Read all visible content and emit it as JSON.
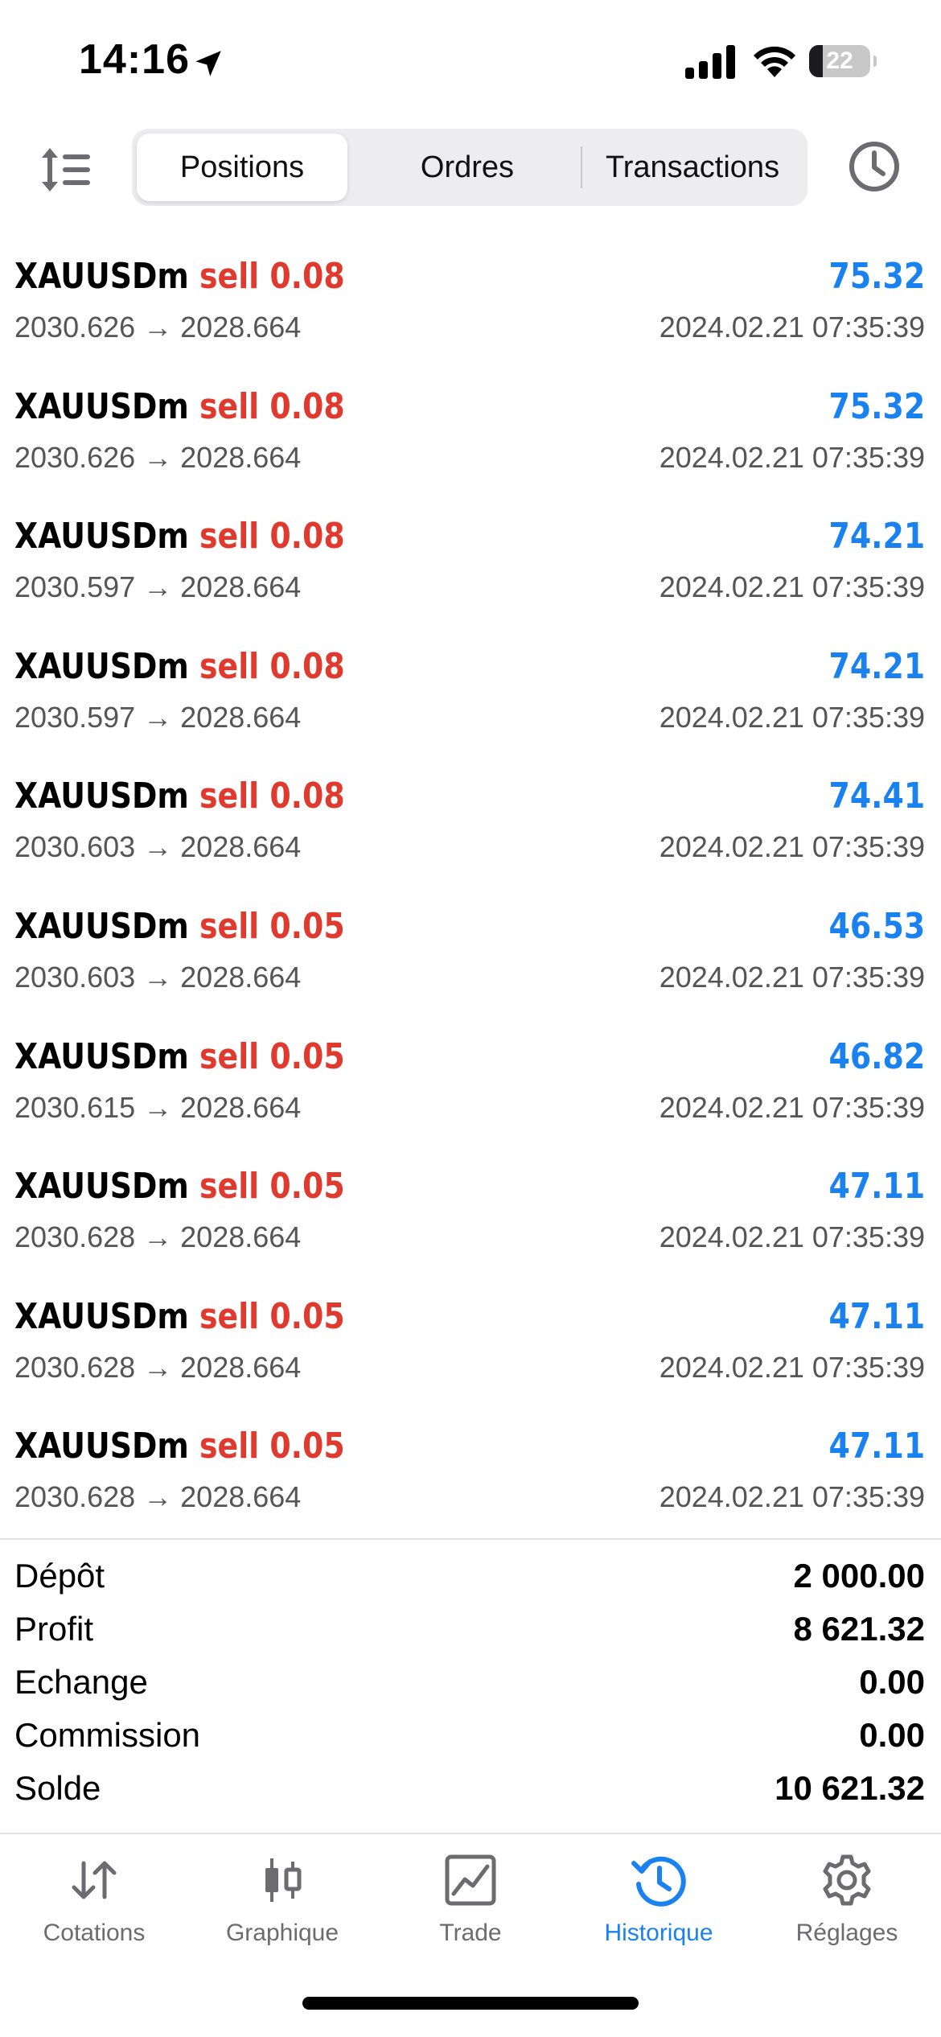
{
  "status_bar": {
    "time": "14:16",
    "battery": "22",
    "battery_level": 0.22,
    "icons": [
      "location-arrow-icon",
      "cellular-signal-icon",
      "wifi-icon",
      "battery-icon"
    ]
  },
  "toolbar": {
    "sort_icon": "sort-icon",
    "tabs": [
      {
        "label": "Positions",
        "active": true
      },
      {
        "label": "Ordres",
        "active": false
      },
      {
        "label": "Transactions",
        "active": false
      }
    ],
    "history_icon": "clock-icon"
  },
  "positions": [
    {
      "symbol": "XAUUSDm",
      "side": "sell 0.08",
      "profit": "75.32",
      "prices": "2030.626 → 2028.664",
      "time": "2024.02.21 07:35:39"
    },
    {
      "symbol": "XAUUSDm",
      "side": "sell 0.08",
      "profit": "75.32",
      "prices": "2030.626 → 2028.664",
      "time": "2024.02.21 07:35:39"
    },
    {
      "symbol": "XAUUSDm",
      "side": "sell 0.08",
      "profit": "74.21",
      "prices": "2030.597 → 2028.664",
      "time": "2024.02.21 07:35:39"
    },
    {
      "symbol": "XAUUSDm",
      "side": "sell 0.08",
      "profit": "74.21",
      "prices": "2030.597 → 2028.664",
      "time": "2024.02.21 07:35:39"
    },
    {
      "symbol": "XAUUSDm",
      "side": "sell 0.08",
      "profit": "74.41",
      "prices": "2030.603 → 2028.664",
      "time": "2024.02.21 07:35:39"
    },
    {
      "symbol": "XAUUSDm",
      "side": "sell 0.05",
      "profit": "46.53",
      "prices": "2030.603 → 2028.664",
      "time": "2024.02.21 07:35:39"
    },
    {
      "symbol": "XAUUSDm",
      "side": "sell 0.05",
      "profit": "46.82",
      "prices": "2030.615 → 2028.664",
      "time": "2024.02.21 07:35:39"
    },
    {
      "symbol": "XAUUSDm",
      "side": "sell 0.05",
      "profit": "47.11",
      "prices": "2030.628 → 2028.664",
      "time": "2024.02.21 07:35:39"
    },
    {
      "symbol": "XAUUSDm",
      "side": "sell 0.05",
      "profit": "47.11",
      "prices": "2030.628 → 2028.664",
      "time": "2024.02.21 07:35:39"
    },
    {
      "symbol": "XAUUSDm",
      "side": "sell 0.05",
      "profit": "47.11",
      "prices": "2030.628 → 2028.664",
      "time": "2024.02.21 07:35:39"
    }
  ],
  "summary": [
    {
      "label": "Dépôt",
      "value": "2 000.00"
    },
    {
      "label": "Profit",
      "value": "8 621.32"
    },
    {
      "label": "Echange",
      "value": "0.00"
    },
    {
      "label": "Commission",
      "value": "0.00"
    },
    {
      "label": "Solde",
      "value": "10 621.32"
    }
  ],
  "tabbar": [
    {
      "label": "Cotations",
      "icon": "arrows-updown-icon",
      "active": false
    },
    {
      "label": "Graphique",
      "icon": "candlestick-icon",
      "active": false
    },
    {
      "label": "Trade",
      "icon": "trade-chart-icon",
      "active": false
    },
    {
      "label": "Historique",
      "icon": "history-icon",
      "active": true
    },
    {
      "label": "Réglages",
      "icon": "gear-icon",
      "active": false
    }
  ],
  "colors": {
    "sell": "#e03a2f",
    "profit": "#1a82f0",
    "active_tab": "#1a82f0",
    "inactive_tab": "#6b6b70"
  }
}
